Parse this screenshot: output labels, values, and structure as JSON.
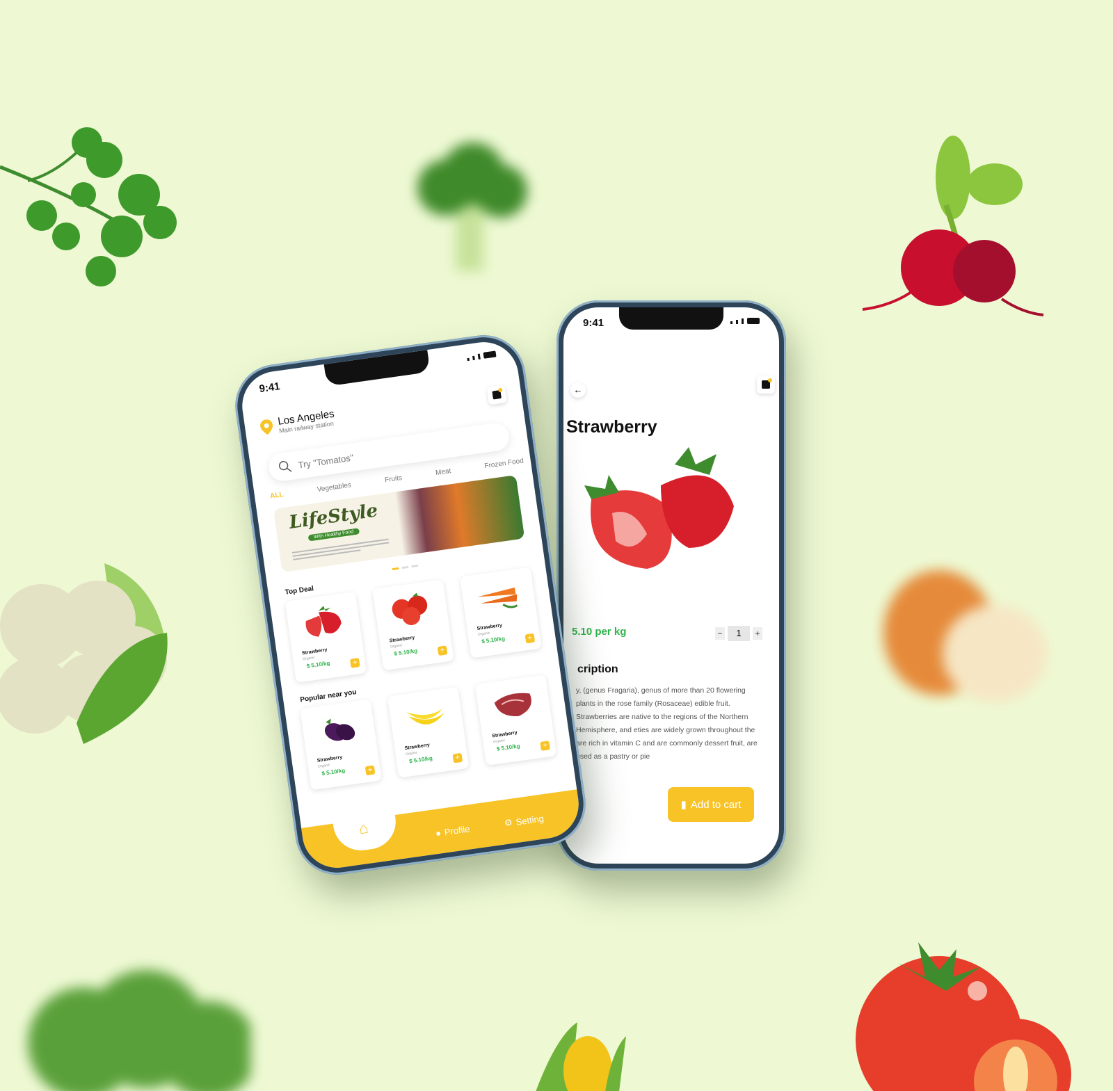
{
  "status": {
    "time": "9:41"
  },
  "home": {
    "location": {
      "city": "Los Angeles",
      "subtitle": "Main railway station"
    },
    "search": {
      "placeholder": "Try \"Tomatos\""
    },
    "categories": [
      "ALL",
      "Vegetables",
      "Fruits",
      "Meat",
      "Frozen Food"
    ],
    "banner": {
      "title": "LifeStyle",
      "tagline": "With Healthy Food"
    },
    "top_deal": {
      "title": "Top Deal",
      "items": [
        {
          "name": "Strawberry",
          "tag": "Organic",
          "price": "$ 5.10/kg",
          "image": "strawberry"
        },
        {
          "name": "Strawberry",
          "tag": "Organic",
          "price": "$ 5.10/kg",
          "image": "tomato"
        },
        {
          "name": "Strawberry",
          "tag": "Organic",
          "price": "$ 5.10/kg",
          "image": "carrot"
        }
      ]
    },
    "popular": {
      "title": "Popular near you",
      "items": [
        {
          "name": "Strawberry",
          "tag": "Organic",
          "price": "$ 5.10/kg",
          "image": "eggplant"
        },
        {
          "name": "Strawberry",
          "tag": "Organic",
          "price": "$ 5.10/kg",
          "image": "banana"
        },
        {
          "name": "Strawberry",
          "tag": "Organic",
          "price": "$ 5.10/kg",
          "image": "meat"
        }
      ]
    },
    "nav": {
      "profile": "Profile",
      "setting": "Setting"
    }
  },
  "detail": {
    "title": "Strawberry",
    "price": "5.10 per kg",
    "quantity": "1",
    "description_title": "cription",
    "description": "y, (genus Fragaria), genus of more than 20 flowering plants in the rose family (Rosaceae) edible fruit. Strawberries are native to the regions of the Northern Hemisphere, and eties are widely grown throughout the are rich in vitamin C and are commonly dessert fruit, are used as a pastry or pie",
    "add_to_cart": "Add to cart"
  },
  "colors": {
    "accent": "#f7c326",
    "price_green": "#2fb34a",
    "background": "#eef9d3"
  }
}
